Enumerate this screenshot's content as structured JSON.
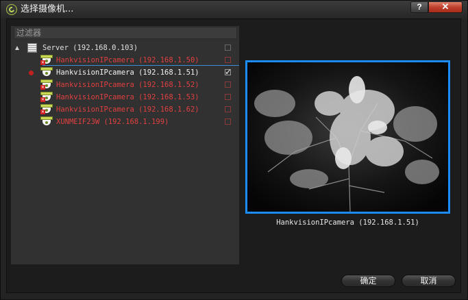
{
  "window": {
    "title": "选择摄像机...",
    "help_label": "?",
    "close_label": "✕"
  },
  "filter": {
    "placeholder": "过滤器"
  },
  "tree": {
    "server": {
      "label": "Server (192.168.0.103)"
    },
    "cameras": [
      {
        "label": "HankvisionIPcamera (192.168.1.50)",
        "status": "offline",
        "checked": false
      },
      {
        "label": "HankvisionIPcamera (192.168.1.51)",
        "status": "online",
        "checked": true
      },
      {
        "label": "HankvisionIPcamera (192.168.1.52)",
        "status": "offline",
        "checked": false
      },
      {
        "label": "HankvisionIPcamera (192.168.1.53)",
        "status": "offline",
        "checked": false
      },
      {
        "label": "HankvisionIPcamera (192.168.1.62)",
        "status": "offline",
        "checked": false
      },
      {
        "label": "XUNMEIF23W (192.168.1.199)",
        "status": "unauthorized",
        "checked": false
      }
    ]
  },
  "preview": {
    "caption": "HankvisionIPcamera (192.168.1.51)"
  },
  "buttons": {
    "ok": "确定",
    "cancel": "取消"
  },
  "colors": {
    "selection_border": "#1a8cff",
    "offline_text": "#e04040",
    "accent_icon": "#c9d956"
  }
}
